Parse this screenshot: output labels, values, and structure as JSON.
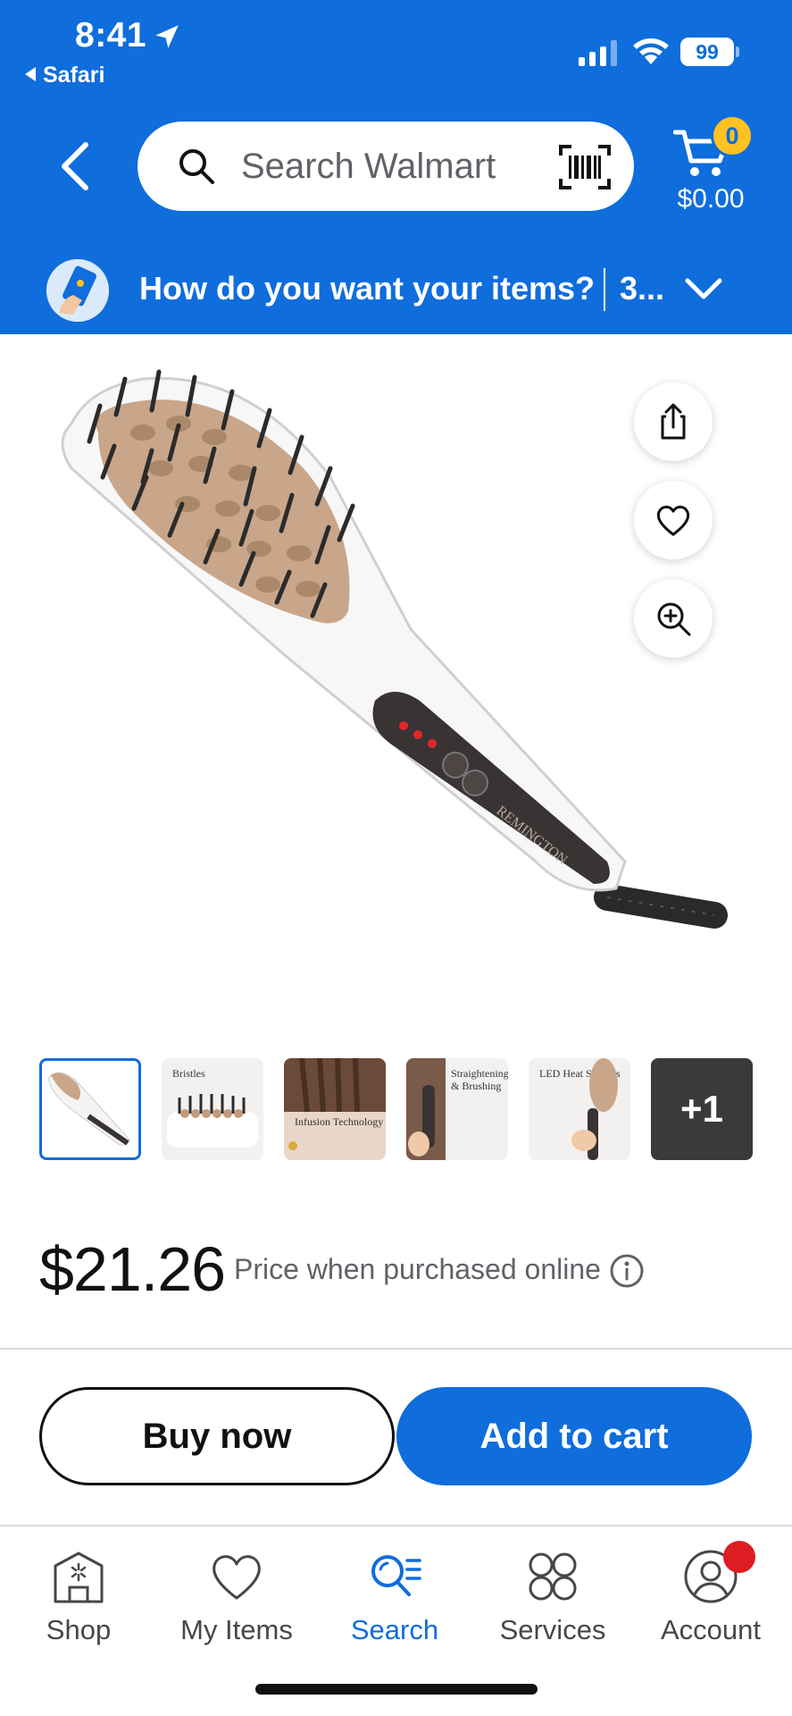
{
  "status_bar": {
    "time": "8:41",
    "back_app": "Safari",
    "battery": "99"
  },
  "header": {
    "search_placeholder": "Search Walmart",
    "cart_count": "0",
    "cart_total": "$0.00"
  },
  "delivery": {
    "question": "How do you want your items?",
    "extra": "3..."
  },
  "product": {
    "more_images": "+1",
    "thumbnails": [
      {
        "caption": ""
      },
      {
        "caption": "Bristles"
      },
      {
        "caption": "Infusion Technology"
      },
      {
        "caption": "Straightening & Brushing"
      },
      {
        "caption": "LED Heat Settings"
      }
    ],
    "price": "$21.26",
    "price_note": "Price when purchased online"
  },
  "actions": {
    "buy_now": "Buy now",
    "add_to_cart": "Add to cart"
  },
  "tabs": [
    {
      "label": "Shop",
      "icon": "shop-icon"
    },
    {
      "label": "My Items",
      "icon": "heart-icon"
    },
    {
      "label": "Search",
      "icon": "search-list-icon",
      "active": true
    },
    {
      "label": "Services",
      "icon": "services-grid-icon"
    },
    {
      "label": "Account",
      "icon": "account-icon"
    }
  ],
  "colors": {
    "brand_blue": "#0f6ddc",
    "badge_yellow": "#ffc220",
    "alert_red": "#de1c24"
  }
}
